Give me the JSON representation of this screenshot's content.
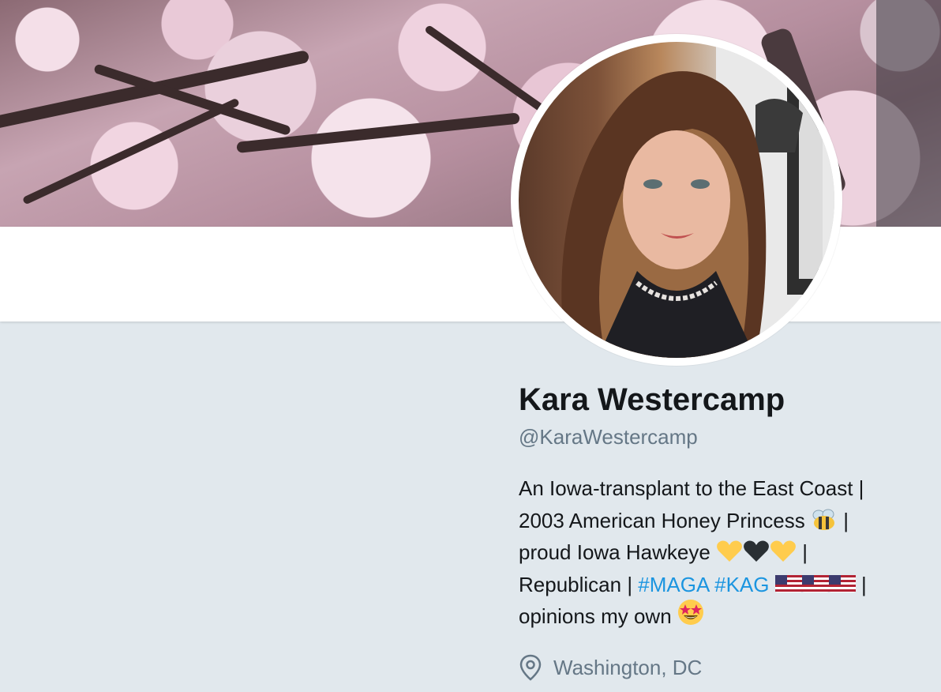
{
  "profile": {
    "name": "Kara Westercamp",
    "handle": "@KaraWestercamp",
    "location": "Washington, DC",
    "location_icon": "location-pin-icon"
  },
  "bio": {
    "line1_text": "An Iowa-transplant to the East Coast |",
    "line2_text": "2003 American Honey Princess",
    "line2_emoji": "bee-emoji",
    "line2_tail": " |",
    "line3_text": "proud Iowa Hawkeye ",
    "line3_emojis": [
      "yellow-heart-emoji",
      "black-heart-emoji",
      "yellow-heart-emoji"
    ],
    "line3_tail": " |",
    "line4_text": "Republican | ",
    "hashtag1": "#MAGA",
    "hashtag2": "#KAG",
    "line4_emojis": [
      "us-flag-emoji",
      "us-flag-emoji",
      "us-flag-emoji"
    ],
    "line4_tail": " |",
    "line5_text": "opinions my own ",
    "line5_emoji": "star-struck-emoji"
  },
  "colors": {
    "background": "#e1e8ed",
    "name": "#14171a",
    "secondary_text": "#657786",
    "hashtag": "#1b95e0"
  }
}
